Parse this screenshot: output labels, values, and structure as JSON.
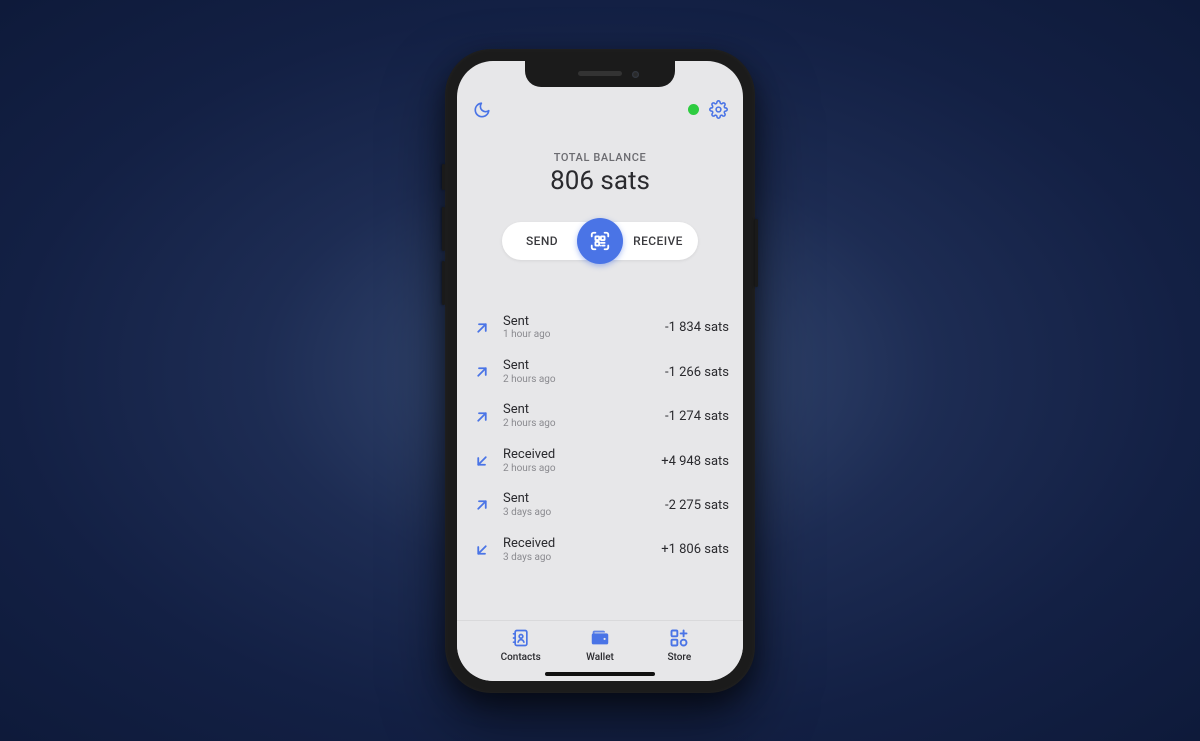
{
  "balance": {
    "label": "TOTAL BALANCE",
    "value": "806 sats"
  },
  "actions": {
    "send": "SEND",
    "receive": "RECEIVE"
  },
  "transactions": [
    {
      "direction": "sent",
      "title": "Sent",
      "time": "1 hour ago",
      "amount": "-1 834 sats"
    },
    {
      "direction": "sent",
      "title": "Sent",
      "time": "2 hours ago",
      "amount": "-1 266 sats"
    },
    {
      "direction": "sent",
      "title": "Sent",
      "time": "2 hours ago",
      "amount": "-1 274 sats"
    },
    {
      "direction": "received",
      "title": "Received",
      "time": "2 hours ago",
      "amount": "+4 948 sats"
    },
    {
      "direction": "sent",
      "title": "Sent",
      "time": "3 days ago",
      "amount": "-2 275 sats"
    },
    {
      "direction": "received",
      "title": "Received",
      "time": "3 days ago",
      "amount": "+1 806 sats"
    }
  ],
  "tabs": {
    "contacts": "Contacts",
    "wallet": "Wallet",
    "store": "Store"
  }
}
